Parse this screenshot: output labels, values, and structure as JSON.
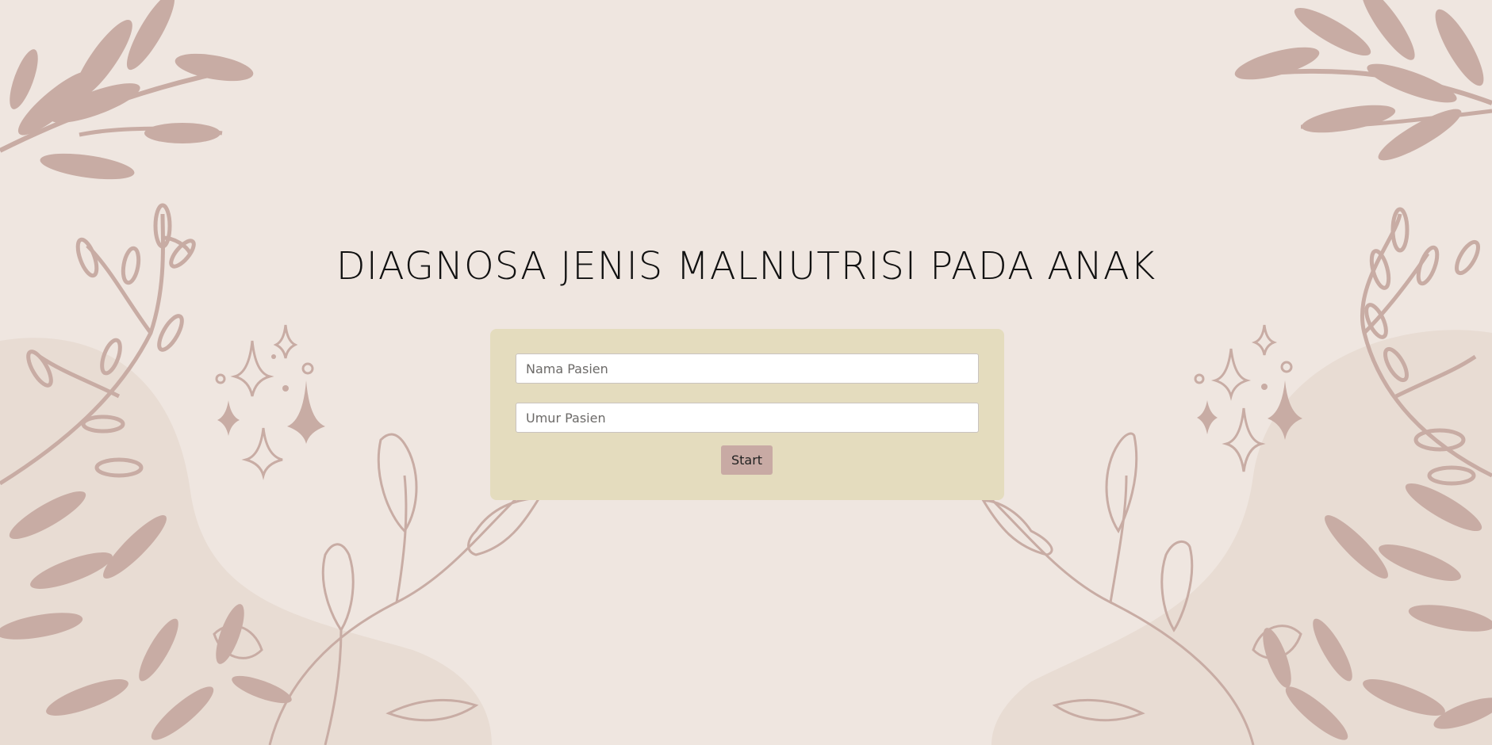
{
  "page": {
    "title": "DIAGNOSA JENIS MALNUTRISI PADA ANAK"
  },
  "form": {
    "name_placeholder": "Nama Pasien",
    "age_placeholder": "Umur Pasien",
    "start_label": "Start"
  },
  "colors": {
    "background": "#efe6e0",
    "card": "#e4dcbe",
    "foliage": "#c8aca4",
    "button": "#c8aaa4"
  }
}
